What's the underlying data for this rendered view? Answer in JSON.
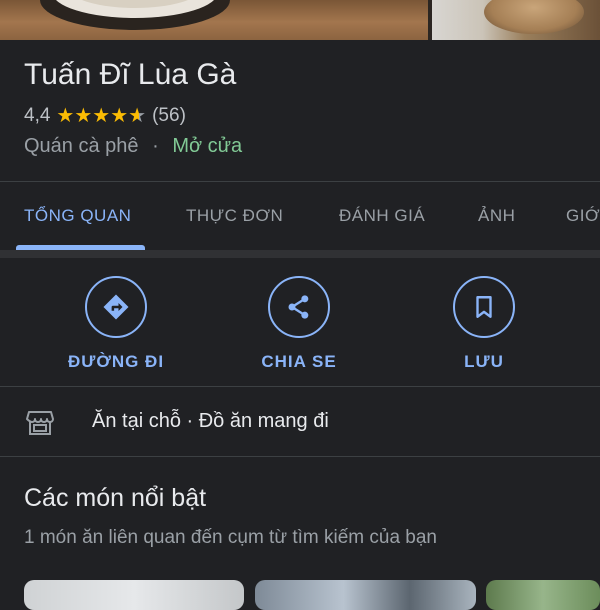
{
  "place": {
    "name": "Tuấn Đĩ Lùa Gà",
    "rating": "4,4",
    "rating_value": 4.4,
    "review_count": "(56)",
    "category": "Quán cà phê",
    "separator": "·",
    "open_status": "Mở cửa"
  },
  "tabs": [
    {
      "label": "TỔNG QUAN",
      "active": true
    },
    {
      "label": "THỰC ĐƠN",
      "active": false
    },
    {
      "label": "ĐÁNH GIÁ",
      "active": false
    },
    {
      "label": "ẢNH",
      "active": false
    },
    {
      "label": "GIỚ",
      "active": false
    }
  ],
  "actions": [
    {
      "label": "ĐƯỜNG ĐI",
      "icon": "directions-icon"
    },
    {
      "label": "CHIA SE",
      "icon": "share-icon"
    },
    {
      "label": "LƯU",
      "icon": "bookmark-icon"
    }
  ],
  "service_options": {
    "icon": "storefront-icon",
    "text": "Ăn tại chỗ · Đồ ăn mang đi"
  },
  "featured": {
    "title": "Các món nổi bật",
    "subtitle": "1 món ăn liên quan đến cụm từ tìm kiếm của bạn"
  },
  "colors": {
    "background": "#202124",
    "accent": "#8ab4f8",
    "star": "#fbbc04",
    "open": "#81c995",
    "muted": "#9aa0a6"
  }
}
